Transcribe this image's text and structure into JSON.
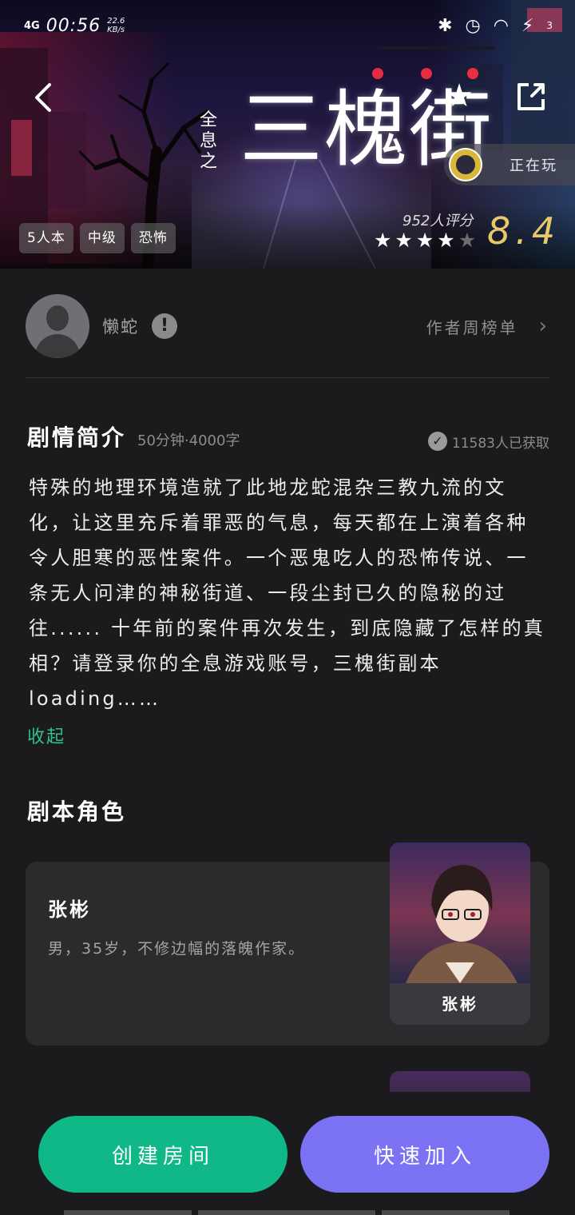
{
  "status_bar": {
    "network": "4G",
    "time": "00:56",
    "speed": "22.6 KB/s",
    "battery": "3"
  },
  "hero": {
    "title_prefix": "全息之",
    "title": "三槐街",
    "playing_label": "正在玩",
    "tags": [
      "5人本",
      "中级",
      "恐怖"
    ],
    "rating_count": "952人评分",
    "score": "8.4",
    "stars_filled": 4,
    "stars_total": 5
  },
  "author": {
    "name": "懒蛇",
    "rank_link": "作者周榜单"
  },
  "synopsis": {
    "title": "剧情简介",
    "meta": "50分钟·4000字",
    "obtained": "11583人已获取",
    "text": "特殊的地理环境造就了此地龙蛇混杂三教九流的文化，让这里充斥着罪恶的气息，每天都在上演着各种令人胆寒的恶性案件。一个恶鬼吃人的恐怖传说、一条无人问津的神秘街道、一段尘封已久的隐秘的过往...... 十年前的案件再次发生，到底隐藏了怎样的真相？请登录你的全息游戏账号，三槐街副本loading……",
    "collapse": "收起"
  },
  "roles": {
    "title": "剧本角色",
    "items": [
      {
        "name": "张彬",
        "desc": "男，35岁，不修边幅的落魄作家。",
        "caption": "张彬"
      }
    ]
  },
  "actions": {
    "create": "创建房间",
    "join": "快速加入"
  },
  "colors": {
    "accent_green": "#10b887",
    "accent_purple": "#7b73f4",
    "score_gold": "#e9c867",
    "background": "#1b1b1d"
  }
}
